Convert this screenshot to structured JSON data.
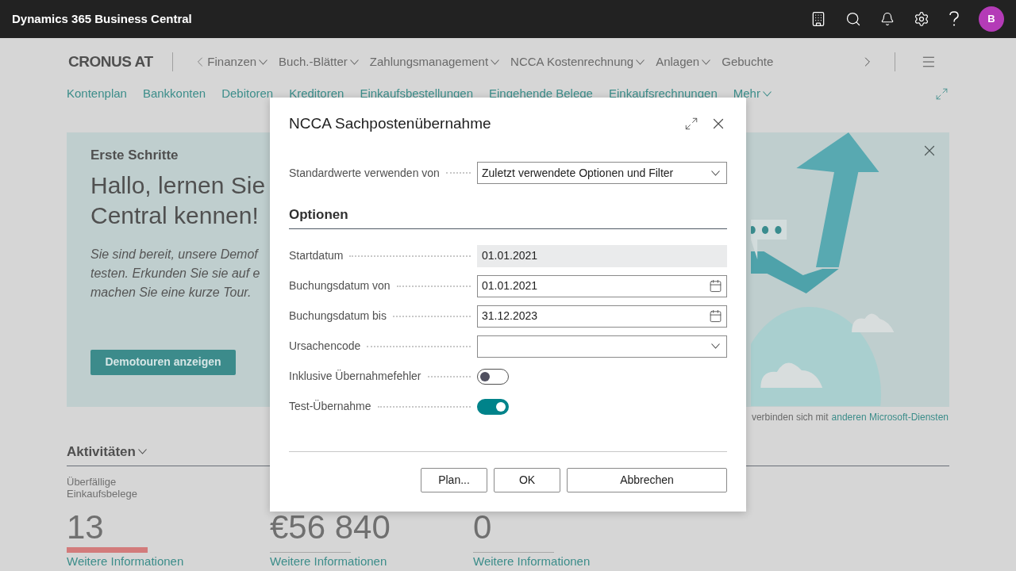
{
  "top_bar": {
    "title": "Dynamics 365 Business Central",
    "avatar": "B"
  },
  "company": "CRONUS AT",
  "menu": [
    "Finanzen",
    "Buch.-Blätter",
    "Zahlungsmanagement",
    "NCCA Kostenrechnung",
    "Anlagen",
    "Gebuchte"
  ],
  "links": [
    "Kontenplan",
    "Bankkonten",
    "Debitoren",
    "Kreditoren",
    "Einkaufsbestellungen",
    "Eingehende Belege",
    "Einkaufsrechnungen",
    "Mehr"
  ],
  "banner": {
    "heading": "Erste Schritte",
    "title_lines": [
      "Hallo, lernen Sie",
      "Central kennen!"
    ],
    "body_lines": [
      "Sie sind bereit, unsere Demof",
      "testen. Erkunden Sie sie auf e",
      "machen Sie eine kurze Tour."
    ],
    "button": "Demotouren anzeigen",
    "footer": "verbinden sich mit",
    "footer_link": "anderen Microsoft-Diensten"
  },
  "activities": {
    "title": "Aktivitäten",
    "tiles": [
      {
        "label": "Überfällige Einkaufsbelege",
        "value": "13",
        "kind": "warning",
        "link": "Weitere Informationen"
      },
      {
        "value": "€56 840",
        "kind": "normal",
        "link": "Weitere Informationen"
      },
      {
        "value": "0",
        "kind": "normal",
        "link": "Weitere Informationen"
      }
    ]
  },
  "dialog": {
    "title": "NCCA Sachpostenübernahme",
    "defaults": {
      "label": "Standardwerte verwenden von",
      "value": "Zuletzt verwendete Optionen und Filter"
    },
    "section": "Optionen",
    "fields": [
      {
        "kind": "readonly",
        "label": "Startdatum",
        "value": "01.01.2021"
      },
      {
        "kind": "date",
        "label": "Buchungsdatum von",
        "value": "01.01.2021"
      },
      {
        "kind": "date",
        "label": "Buchungsdatum bis",
        "value": "31.12.2023"
      },
      {
        "kind": "select",
        "label": "Ursachencode"
      },
      {
        "kind": "toggle",
        "label": "Inklusive Übernahmefehler",
        "on": false
      },
      {
        "kind": "toggle",
        "label": "Test-Übernahme",
        "on": true
      }
    ],
    "buttons": [
      "Plan...",
      "OK",
      "Abbrechen"
    ]
  }
}
